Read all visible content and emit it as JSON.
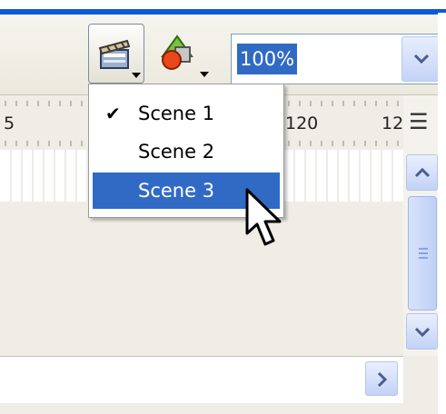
{
  "toolbar": {
    "edit_scene_icon": "clapperboard-icon",
    "edit_symbol_icon": "shapes-icon",
    "zoom": {
      "value": "100%"
    }
  },
  "ruler": {
    "labels": [
      "5",
      "120",
      "12"
    ]
  },
  "scene_menu": {
    "items": [
      {
        "label": "Scene 1",
        "checked": true,
        "highlighted": false
      },
      {
        "label": "Scene 2",
        "checked": false,
        "highlighted": false
      },
      {
        "label": "Scene 3",
        "checked": false,
        "highlighted": true
      }
    ]
  },
  "colors": {
    "selection": "#316ac5",
    "window_border": "#0f58d8",
    "scroll_button": "#c3d2f6"
  }
}
